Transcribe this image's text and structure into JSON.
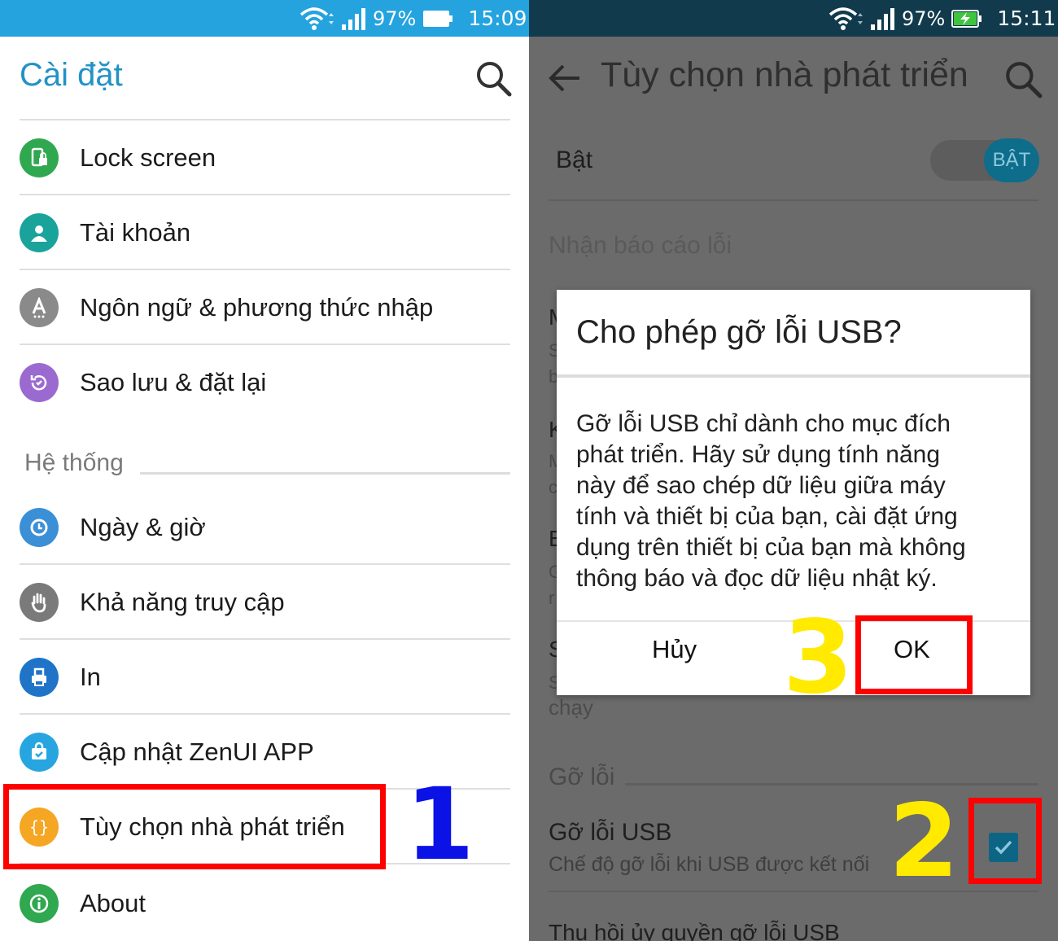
{
  "left_screen": {
    "status": {
      "battery_percent": "97%",
      "time": "15:09"
    },
    "title": "Cài đặt",
    "items": [
      {
        "label": "Lock screen",
        "icon": "lock-screen-icon",
        "color": "#2fa84f"
      },
      {
        "label": "Tài khoản",
        "icon": "account-icon",
        "color": "#1aa39a"
      },
      {
        "label": "Ngôn ngữ & phương thức nhập",
        "icon": "language-icon",
        "color": "#8a8a8a"
      },
      {
        "label": "Sao lưu & đặt lại",
        "icon": "backup-icon",
        "color": "#9b6ad0"
      }
    ],
    "section": "Hệ thống",
    "system_items": [
      {
        "label": "Ngày & giờ",
        "icon": "clock-icon",
        "color": "#3b8fd6"
      },
      {
        "label": "Khả năng truy cập",
        "icon": "hand-icon",
        "color": "#7a7a7a"
      },
      {
        "label": "In",
        "icon": "printer-icon",
        "color": "#1f74c8"
      },
      {
        "label": "Cập nhật ZenUI APP",
        "icon": "update-bag-icon",
        "color": "#27a5e0"
      },
      {
        "label": "Tùy chọn nhà phát triển",
        "icon": "developer-braces-icon",
        "color": "#f5a623"
      },
      {
        "label": "About",
        "icon": "info-icon",
        "color": "#2fa84f"
      }
    ],
    "step_number": "1"
  },
  "right_screen": {
    "status": {
      "battery_percent": "97%",
      "time": "15:11"
    },
    "title": "Tùy chọn nhà phát triển",
    "master_toggle": {
      "label": "Bật",
      "state_label": "BẬT"
    },
    "bug_report": "Nhận báo cáo lỗi",
    "partial_letters": [
      "M",
      "S",
      "b",
      "K",
      "M",
      "c",
      "E",
      "G",
      "r",
      "S",
      "S"
    ],
    "partial_running": "chạy",
    "section": "Gỡ lỗi",
    "usb_debug": {
      "title": "Gỡ lỗi USB",
      "subtitle": "Chế độ gỡ lỗi khi USB được kết nối",
      "checked": true
    },
    "revoke": "Thu hồi ủy quyền gỡ lỗi USB",
    "step_number_checkbox": "2",
    "dialog": {
      "title": "Cho phép gỡ lỗi USB?",
      "body_lines": [
        "Gỡ lỗi USB chỉ dành cho mục đích",
        "phát triển. Hãy sử dụng tính năng",
        "này để sao chép dữ liệu giữa máy",
        "tính và thiết bị của bạn, cài đặt ứng",
        "dụng trên thiết bị của bạn mà không",
        "thông báo và đọc dữ liệu nhật ký."
      ],
      "cancel": "Hủy",
      "ok": "OK"
    },
    "step_number_ok": "3"
  },
  "colors": {
    "left_statusbar": "#24a3df",
    "right_statusbar": "#113a4c",
    "title_blue": "#2392c6",
    "highlight_red": "#ff0000",
    "step1_blue": "#0a12e6",
    "step_yellow": "#ffea00"
  }
}
